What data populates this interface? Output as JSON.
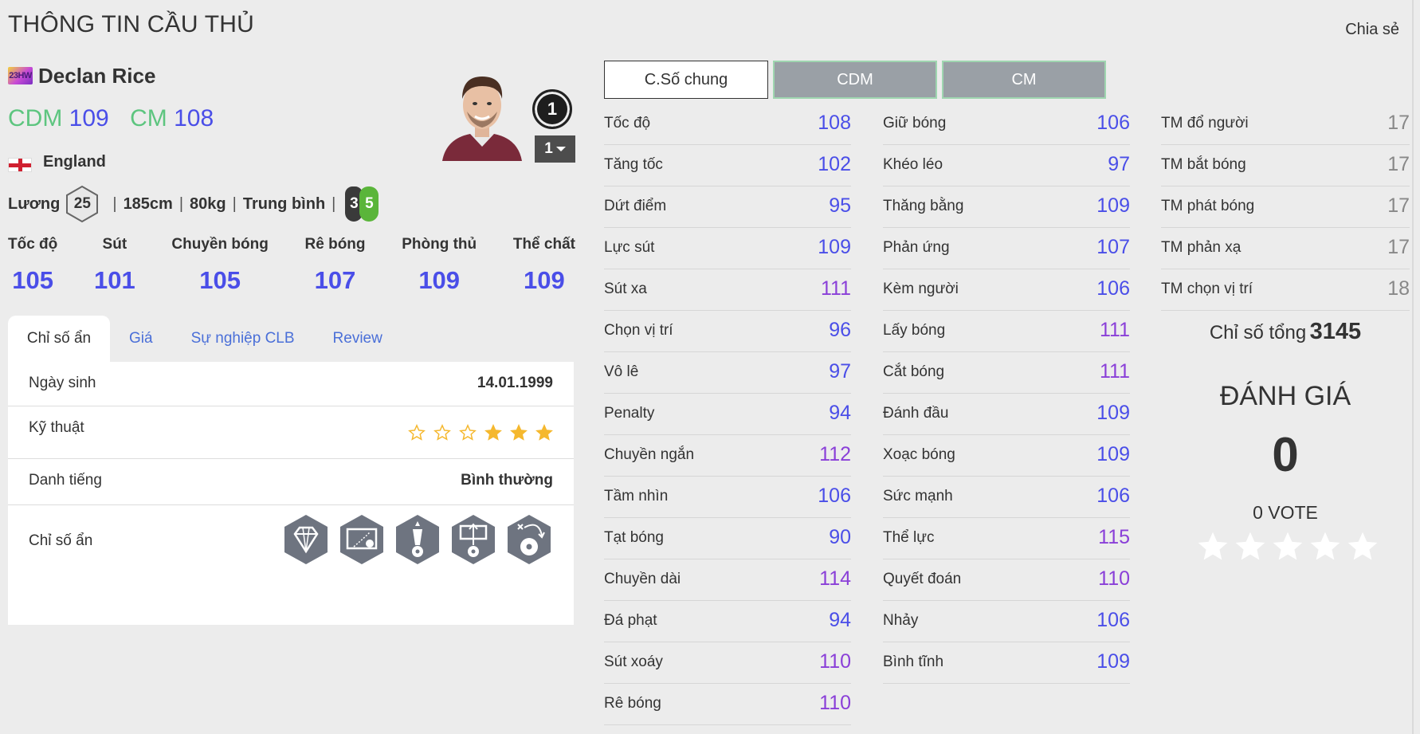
{
  "header": {
    "title": "THÔNG TIN CẦU THỦ",
    "share_label": "Chia sẻ"
  },
  "player": {
    "season_badge": "23HW",
    "name": "Declan Rice",
    "positions": [
      {
        "pos": "CDM",
        "ovr": "109"
      },
      {
        "pos": "CM",
        "ovr": "108"
      }
    ],
    "nation": "England",
    "salary_label": "Lương",
    "salary": "25",
    "height": "185cm",
    "weight": "80kg",
    "body_type": "Trung bình",
    "foot_left": "3",
    "foot_right": "5",
    "rank": "1",
    "upgrade_level": "1"
  },
  "main_stats": [
    {
      "label": "Tốc độ",
      "value": "105"
    },
    {
      "label": "Sút",
      "value": "101"
    },
    {
      "label": "Chuyền bóng",
      "value": "105"
    },
    {
      "label": "Rê bóng",
      "value": "107"
    },
    {
      "label": "Phòng thủ",
      "value": "109"
    },
    {
      "label": "Thể chất",
      "value": "109"
    }
  ],
  "tabs": [
    "Chỉ số ẩn",
    "Giá",
    "Sự nghiệp CLB",
    "Review"
  ],
  "details": {
    "birthday_label": "Ngày sinh",
    "birthday": "14.01.1999",
    "skill_label": "Kỹ thuật",
    "skill_stars": 3,
    "skill_stars_max": 6,
    "reputation_label": "Danh tiếng",
    "reputation": "Bình thường",
    "traits_label": "Chỉ số ẩn",
    "traits": [
      "diamond-trait-icon",
      "finesse-shot-trait-icon",
      "long-shot-trait-icon",
      "power-header-trait-icon",
      "long-pass-trait-icon"
    ]
  },
  "position_tabs": [
    "C.Số chung",
    "CDM",
    "CM"
  ],
  "stats_col1": [
    {
      "name": "Tốc độ",
      "value": "108"
    },
    {
      "name": "Tăng tốc",
      "value": "102"
    },
    {
      "name": "Dứt điểm",
      "value": "95"
    },
    {
      "name": "Lực sút",
      "value": "109"
    },
    {
      "name": "Sút xa",
      "value": "111"
    },
    {
      "name": "Chọn vị trí",
      "value": "96"
    },
    {
      "name": "Vô lê",
      "value": "97"
    },
    {
      "name": "Penalty",
      "value": "94"
    },
    {
      "name": "Chuyền ngắn",
      "value": "112"
    },
    {
      "name": "Tầm nhìn",
      "value": "106"
    },
    {
      "name": "Tạt bóng",
      "value": "90"
    },
    {
      "name": "Chuyền dài",
      "value": "114"
    },
    {
      "name": "Đá phạt",
      "value": "94"
    },
    {
      "name": "Sút xoáy",
      "value": "110"
    },
    {
      "name": "Rê bóng",
      "value": "110"
    }
  ],
  "stats_col2": [
    {
      "name": "Giữ bóng",
      "value": "106"
    },
    {
      "name": "Khéo léo",
      "value": "97"
    },
    {
      "name": "Thăng bằng",
      "value": "109"
    },
    {
      "name": "Phản ứng",
      "value": "107"
    },
    {
      "name": "Kèm người",
      "value": "106"
    },
    {
      "name": "Lấy bóng",
      "value": "111"
    },
    {
      "name": "Cắt bóng",
      "value": "111"
    },
    {
      "name": "Đánh đầu",
      "value": "109"
    },
    {
      "name": "Xoạc bóng",
      "value": "109"
    },
    {
      "name": "Sức mạnh",
      "value": "106"
    },
    {
      "name": "Thể lực",
      "value": "115"
    },
    {
      "name": "Quyết đoán",
      "value": "110"
    },
    {
      "name": "Nhảy",
      "value": "106"
    },
    {
      "name": "Bình tĩnh",
      "value": "109"
    }
  ],
  "stats_col3": [
    {
      "name": "TM đổ người",
      "value": "17"
    },
    {
      "name": "TM bắt bóng",
      "value": "17"
    },
    {
      "name": "TM phát bóng",
      "value": "17"
    },
    {
      "name": "TM phản xạ",
      "value": "17"
    },
    {
      "name": "TM chọn vị trí",
      "value": "18"
    }
  ],
  "summary": {
    "total_label": "Chỉ số tổng",
    "total_value": "3145",
    "rating_title": "ĐÁNH GIÁ",
    "rating_score": "0",
    "vote_count": "0 VOTE",
    "vote_stars_max": 5
  },
  "colors": {
    "position_green": "#5dc57f",
    "stat_blue": "#4a4ee8",
    "stat_purple": "#8a3fd8",
    "star_gold": "#f5b82e"
  }
}
